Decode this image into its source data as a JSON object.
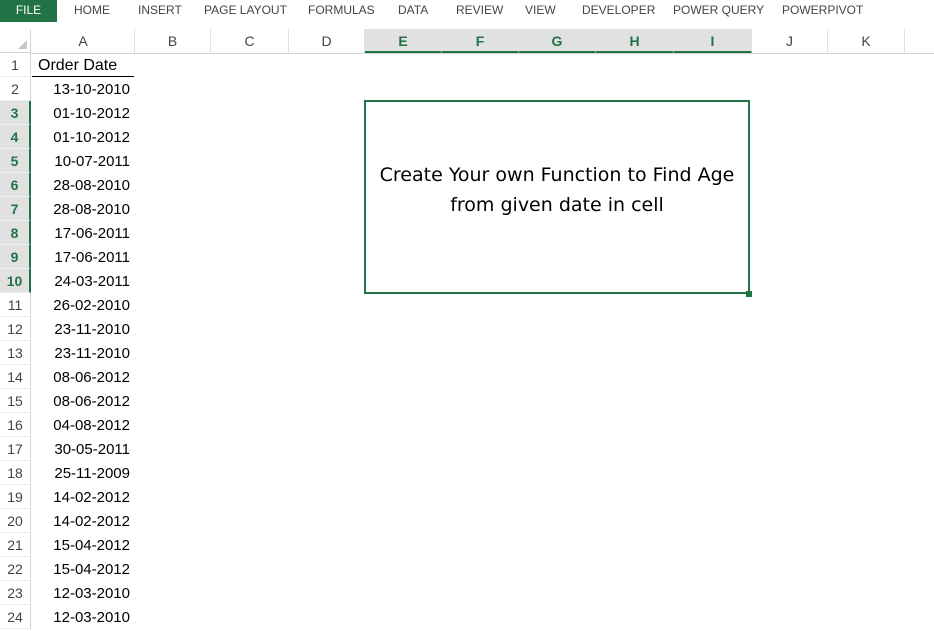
{
  "ribbon": {
    "tabs": [
      "FILE",
      "HOME",
      "INSERT",
      "PAGE LAYOUT",
      "FORMULAS",
      "DATA",
      "REVIEW",
      "VIEW",
      "DEVELOPER",
      "POWER QUERY",
      "POWERPIVOT"
    ]
  },
  "columns": [
    "A",
    "B",
    "C",
    "D",
    "E",
    "F",
    "G",
    "H",
    "I",
    "J",
    "K"
  ],
  "selected_columns": [
    "E",
    "F",
    "G",
    "H",
    "I"
  ],
  "rows": [
    "1",
    "2",
    "3",
    "4",
    "5",
    "6",
    "7",
    "8",
    "9",
    "10",
    "11",
    "12",
    "13",
    "14",
    "15",
    "16",
    "17",
    "18",
    "19",
    "20",
    "21",
    "22",
    "23",
    "24"
  ],
  "selected_rows": [
    "3",
    "4",
    "5",
    "6",
    "7",
    "8",
    "9",
    "10"
  ],
  "sheet": {
    "header": "Order Date",
    "dates": [
      "13-10-2010",
      "01-10-2012",
      "01-10-2012",
      "10-07-2011",
      "28-08-2010",
      "28-08-2010",
      "17-06-2011",
      "17-06-2011",
      "24-03-2011",
      "26-02-2010",
      "23-11-2010",
      "23-11-2010",
      "08-06-2012",
      "08-06-2012",
      "04-08-2012",
      "30-05-2011",
      "25-11-2009",
      "14-02-2012",
      "14-02-2012",
      "15-04-2012",
      "15-04-2012",
      "12-03-2010",
      "12-03-2010"
    ]
  },
  "shape": {
    "text": "Create Your own Function to Find Age\nfrom given date in cell"
  },
  "colors": {
    "accent": "#217346"
  }
}
